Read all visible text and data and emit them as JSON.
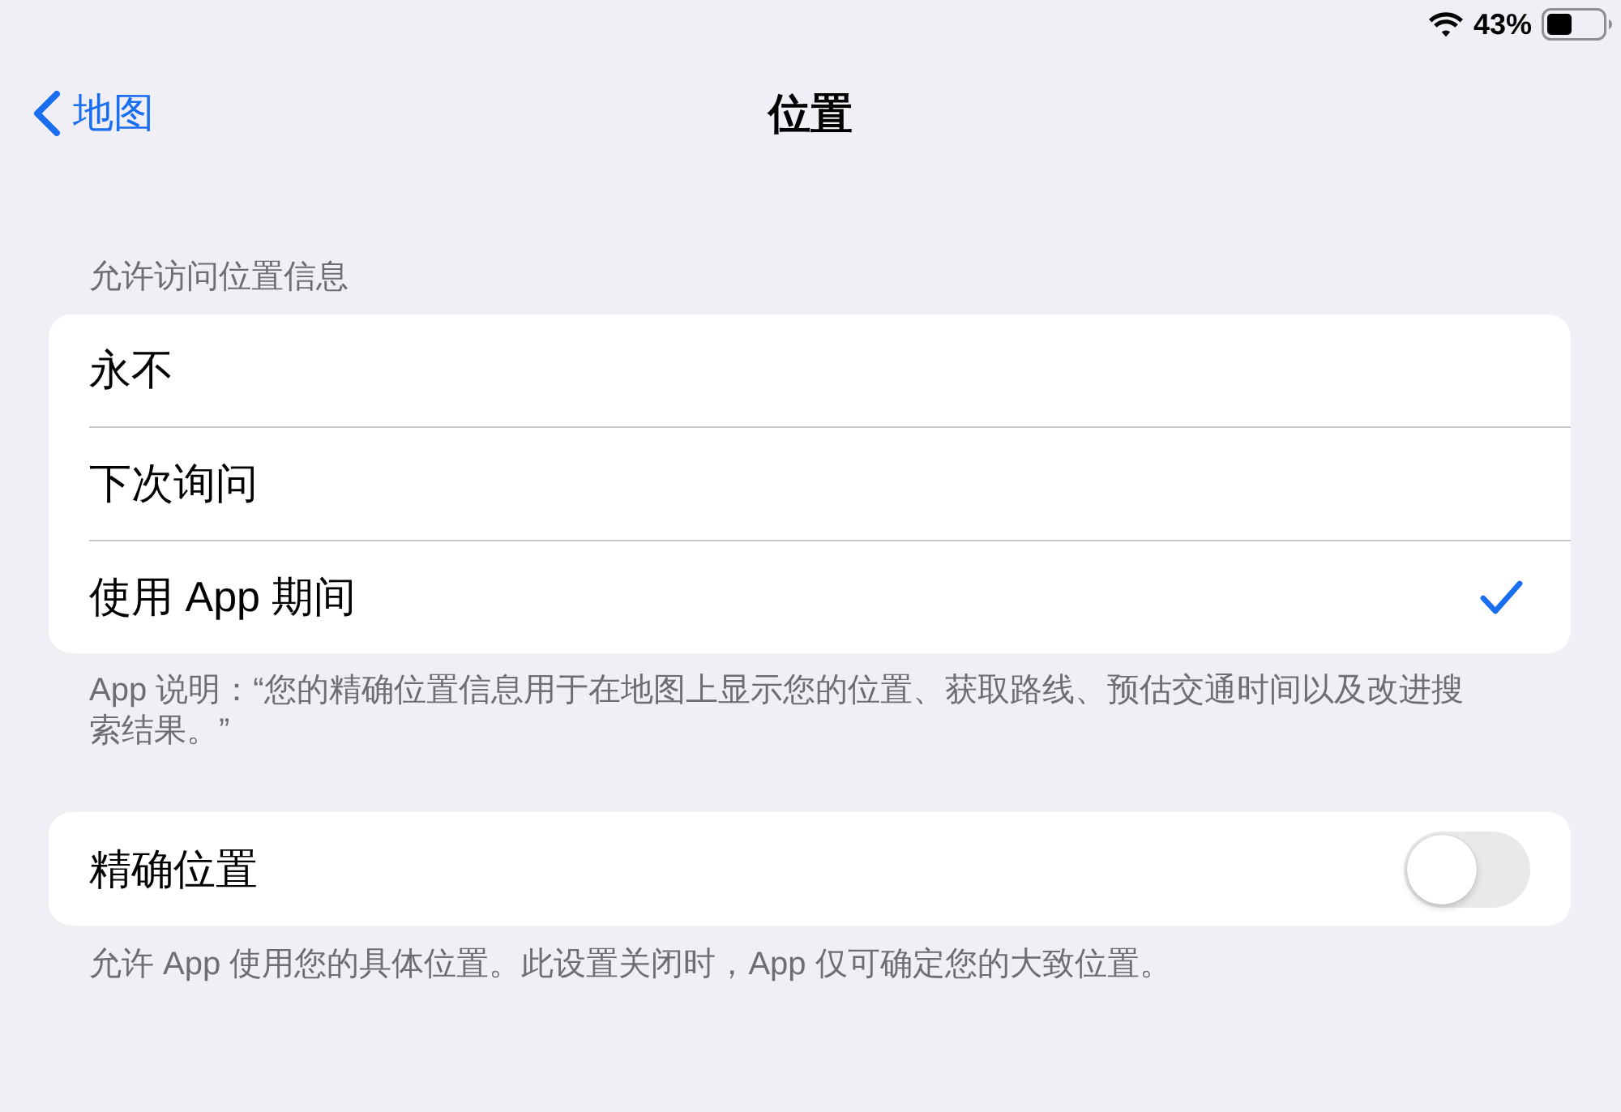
{
  "status_bar": {
    "battery_percent": "43%"
  },
  "nav_bar": {
    "back_label": "地图",
    "title": "位置"
  },
  "location_access": {
    "header": "允许访问位置信息",
    "options": [
      {
        "label": "永不",
        "selected": false
      },
      {
        "label": "下次询问",
        "selected": false
      },
      {
        "label": "使用 App 期间",
        "selected": true
      }
    ],
    "footer": "App 说明：“您的精确位置信息用于在地图上显示您的位置、获取路线、预估交通时间以及改进搜索结果。”"
  },
  "precise_location": {
    "label": "精确位置",
    "on": false,
    "footer": "允许 App 使用您的具体位置。此设置关闭时，App 仅可确定您的大致位置。"
  }
}
